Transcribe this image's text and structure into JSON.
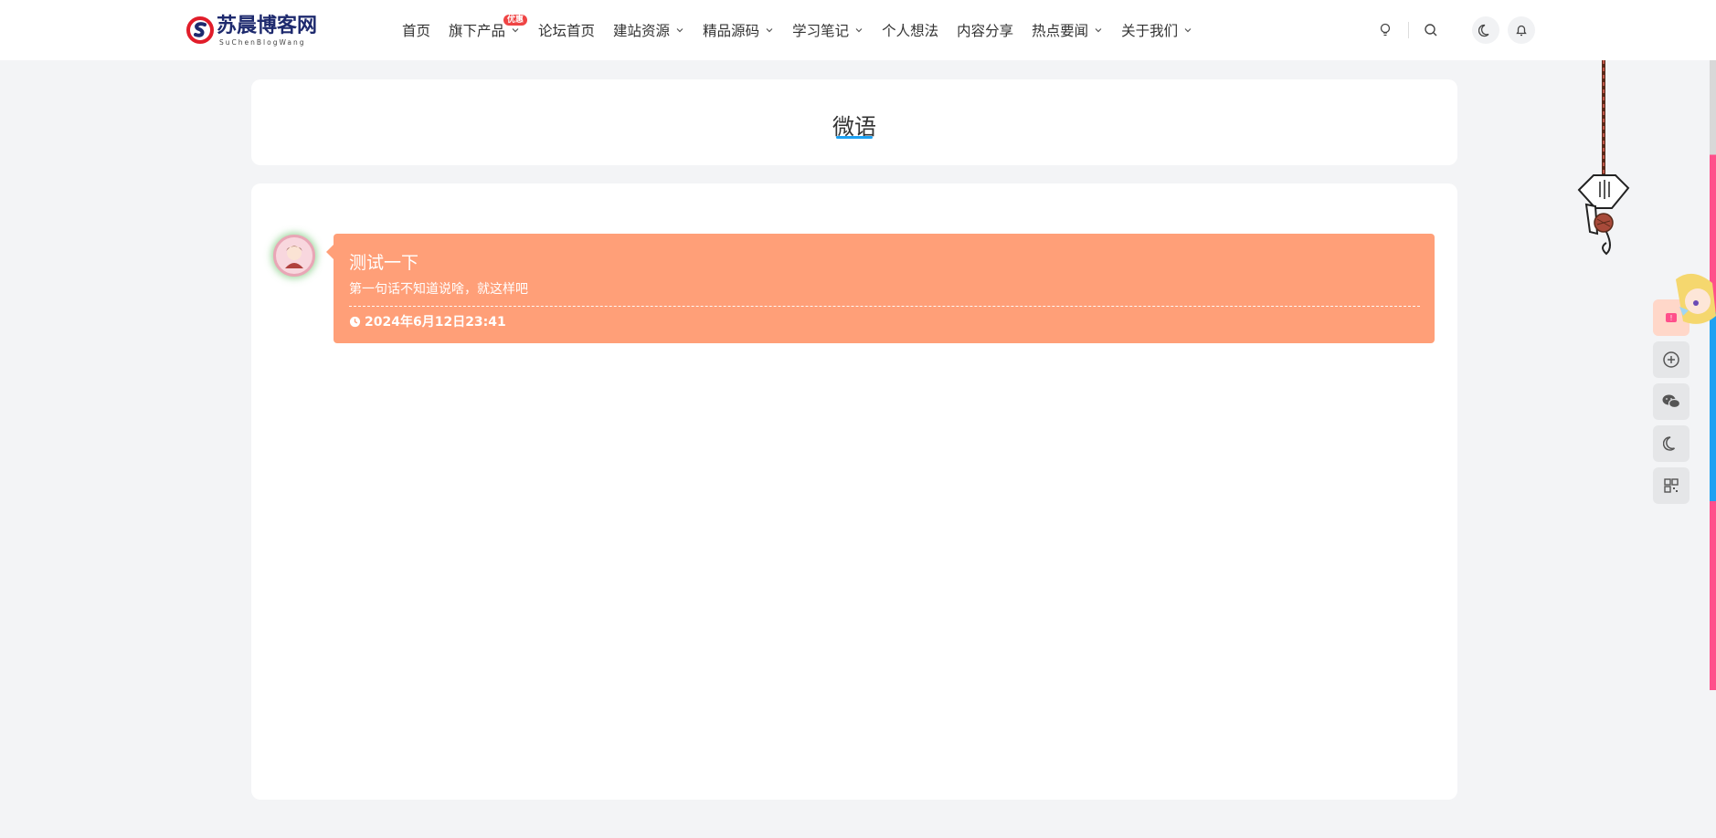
{
  "header": {
    "logo": {
      "name": "苏晨博客网",
      "subtitle": "SuChenBlogWang",
      "icon": "logo-s-icon"
    },
    "nav": [
      {
        "label": "首页",
        "dropdown": false
      },
      {
        "label": "旗下产品",
        "dropdown": true,
        "badge": "优惠"
      },
      {
        "label": "论坛首页",
        "dropdown": false
      },
      {
        "label": "建站资源",
        "dropdown": true
      },
      {
        "label": "精品源码",
        "dropdown": true
      },
      {
        "label": "学习笔记",
        "dropdown": true
      },
      {
        "label": "个人想法",
        "dropdown": false
      },
      {
        "label": "内容分享",
        "dropdown": false
      },
      {
        "label": "热点要闻",
        "dropdown": true
      },
      {
        "label": "关于我们",
        "dropdown": true
      }
    ],
    "icons": [
      "lightbulb-icon",
      "search-icon",
      "moon-icon",
      "bell-icon"
    ]
  },
  "page": {
    "title": "微语"
  },
  "posts": [
    {
      "title": "测试一下",
      "text": "第一句话不知道说啥，就这样吧",
      "date": "2024年6月12日23:41",
      "color": "#ff9f78"
    }
  ],
  "sidebar_tools": [
    "mascot-badge-icon",
    "plus-circle-icon",
    "wechat-icon",
    "moon-icon",
    "qrcode-icon"
  ],
  "colors": {
    "accent": "#1da1f2",
    "post_bg": "#ff9f78",
    "badge": "#ef4444",
    "strip_pink": "#ff4f8b"
  }
}
